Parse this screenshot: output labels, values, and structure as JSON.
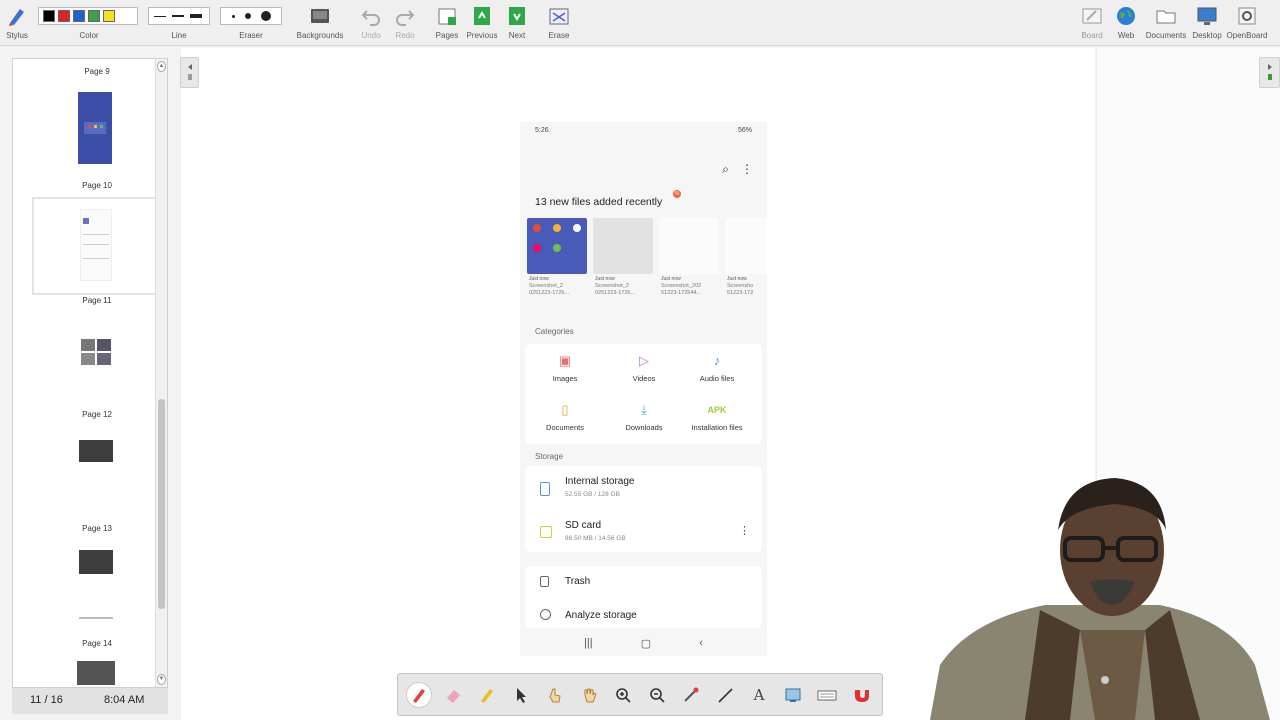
{
  "toolbar": {
    "stylus": "Stylus",
    "color": "Color",
    "line": "Line",
    "eraser": "Eraser",
    "backgrounds": "Backgrounds",
    "undo": "Undo",
    "redo": "Redo",
    "pages": "Pages",
    "previous": "Previous",
    "next": "Next",
    "erase": "Erase",
    "board": "Board",
    "web": "Web",
    "documents": "Documents",
    "desktop": "Desktop",
    "openboard": "OpenBoard",
    "colors": [
      "#000000",
      "#e02020",
      "#1f5fd0",
      "#3aa04a",
      "#f2e21c"
    ]
  },
  "sidebar": {
    "pages": [
      "Page 9",
      "Page 10",
      "Page 11",
      "Page 12",
      "Page 13",
      "Page 14"
    ],
    "page_counter": "11 / 16",
    "clock": "8:04 AM"
  },
  "phone": {
    "status_time": "5:26",
    "status_battery": "56%",
    "recent_title": "13 new files added recently",
    "badge": "N",
    "recent_files": [
      {
        "when": "Just now",
        "name": "Screenshot_2",
        "name2": "0251223-1726..."
      },
      {
        "when": "Just now",
        "name": "Screenshot_2",
        "name2": "0251223-1726..."
      },
      {
        "when": "Just now",
        "name": "Screenshot_202",
        "name2": "51223-172544..."
      },
      {
        "when": "Just now",
        "name": "Screensho",
        "name2": "51223-172"
      }
    ],
    "categories_label": "Categories",
    "categories": [
      "Images",
      "Videos",
      "Audio files",
      "Documents",
      "Downloads",
      "Installation files"
    ],
    "apk_label": "APK",
    "storage_label": "Storage",
    "internal_name": "Internal storage",
    "internal_size": "52.55 GB / 128 GB",
    "sd_name": "SD card",
    "sd_size": "86.50 MB / 14.56 GB",
    "trash": "Trash",
    "analyze": "Analyze storage"
  }
}
